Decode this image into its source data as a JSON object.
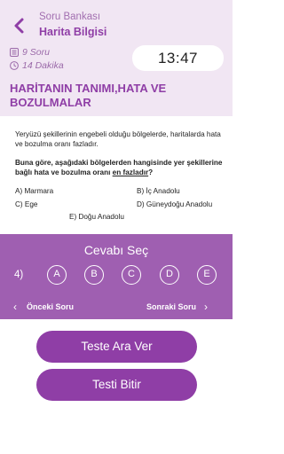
{
  "header": {
    "breadcrumb_top": "Soru Bankası",
    "breadcrumb_main": "Harita Bilgisi",
    "question_count": "9 Soru",
    "duration": "14 Dakika",
    "timer": "13:47",
    "topic_title": "HARİTANIN TANIMI,HATA VE BOZULMALAR"
  },
  "question": {
    "intro": "Yeryüzü şekillerinin engebeli olduğu bölgelerde, haritalarda hata ve bozulma oranı fazladır.",
    "stem_start": "Buna göre, aşağıdaki bölgelerden hangisinde yer şekillerine bağlı hata ve bozulma oranı ",
    "stem_emphasis": "en fazladır",
    "stem_end": "?",
    "options": [
      {
        "key": "A",
        "text": "A) Marmara"
      },
      {
        "key": "B",
        "text": "B) İç Anadolu"
      },
      {
        "key": "C",
        "text": "C) Ege"
      },
      {
        "key": "D",
        "text": "D) Güneydoğu Anadolu"
      },
      {
        "key": "E",
        "text": "E) Doğu Anadolu"
      }
    ]
  },
  "answer_panel": {
    "title": "Cevabı Seç",
    "question_number": "4)",
    "choices": [
      "A",
      "B",
      "C",
      "D",
      "E"
    ],
    "prev_label": "Önceki Soru",
    "next_label": "Sonraki Soru"
  },
  "actions": {
    "pause_label": "Teste Ara Ver",
    "finish_label": "Testi Bitir"
  },
  "colors": {
    "accent": "#8f3ea6",
    "panel": "#9f5fb1",
    "header_bg": "#f1e6f3"
  },
  "icons": {
    "back": "chevron-left-icon",
    "question_count": "list-icon",
    "duration": "clock-icon"
  }
}
